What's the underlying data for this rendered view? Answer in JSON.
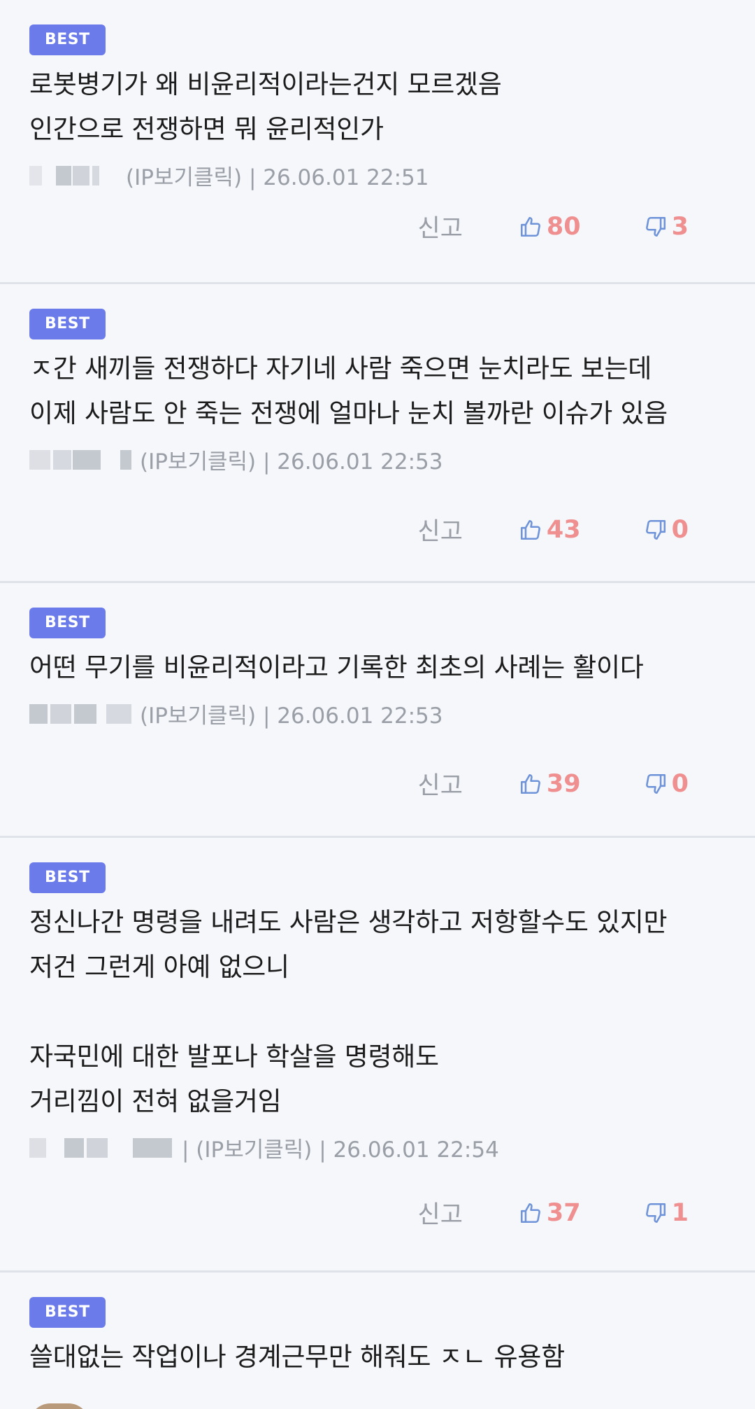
{
  "badge_label": "BEST",
  "report_label": "신고",
  "comments": [
    {
      "text": "로봇병기가 왜 비윤리적이라는건지 모르겠음\n인간으로 전쟁하면 뭐 윤리적인가",
      "meta": "(IP보기클릭) | 26.06.01 22:51",
      "likes": "80",
      "dislikes": "3"
    },
    {
      "text": "ㅈ간 새끼들 전쟁하다 자기네 사람 죽으면 눈치라도 보는데\n이제 사람도 안 죽는 전쟁에 얼마나 눈치 볼까란 이슈가 있음",
      "meta": "(IP보기클릭) | 26.06.01 22:53",
      "likes": "43",
      "dislikes": "0"
    },
    {
      "text": "어떤 무기를 비윤리적이라고 기록한 최초의 사례는 활이다",
      "meta": "(IP보기클릭) | 26.06.01 22:53",
      "likes": "39",
      "dislikes": "0"
    },
    {
      "text": "정신나간 명령을 내려도 사람은 생각하고 저항할수도 있지만\n저건 그런게 아예 없으니\n\n자국민에 대한 발포나 학살을 명령해도\n거리낌이 전혀 없을거임",
      "meta": "| (IP보기클릭) | 26.06.01 22:54",
      "likes": "37",
      "dislikes": "1"
    },
    {
      "text": "쓸대없는 작업이나 경계근무만 해줘도 ㅈㄴ 유용함"
    }
  ],
  "colors": {
    "badge": "#6b7bea",
    "vote_count": "#ef8f8f",
    "thumb_icon": "#6f93d8",
    "meta_text": "#9a9ea6"
  }
}
